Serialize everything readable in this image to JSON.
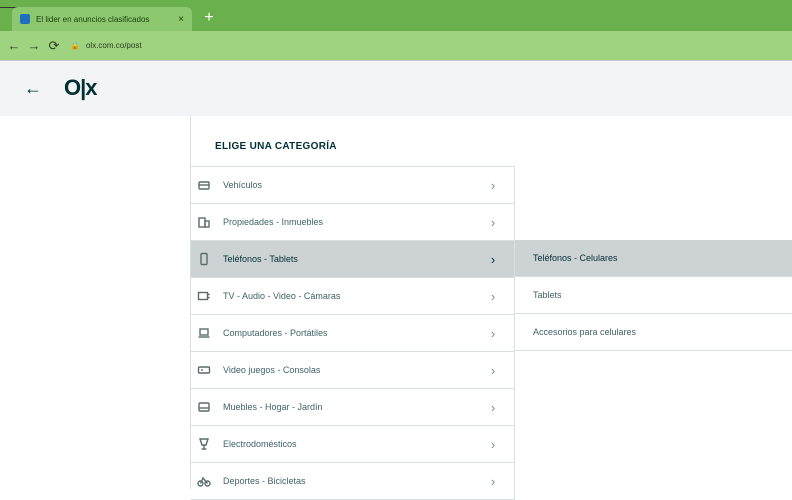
{
  "browser": {
    "tab": {
      "title": "El lider en anuncios clasificados",
      "favicon": "olx-favicon",
      "close": "×"
    },
    "new_tab": "+",
    "nav": {
      "back": "←",
      "forward": "→",
      "reload": "⟳"
    },
    "omnibox": {
      "lock": "🔒",
      "url": "olx.com.co/post"
    },
    "colors": {
      "tabstrip": "#6ab04c",
      "toolbar": "#9fd37f"
    }
  },
  "header": {
    "back_icon": "←",
    "logo": "O|x"
  },
  "panel": {
    "title": "ELIGE UNA CATEGORÍA",
    "categories": [
      {
        "label": "Vehículos",
        "icon": "car-icon",
        "selected": false
      },
      {
        "label": "Propiedades - Inmuebles",
        "icon": "building-icon",
        "selected": false
      },
      {
        "label": "Teléfonos - Tablets",
        "icon": "phone-icon",
        "selected": true
      },
      {
        "label": "TV - Audio - Video - Cámaras",
        "icon": "tv-icon",
        "selected": false
      },
      {
        "label": "Computadores - Portátiles",
        "icon": "laptop-icon",
        "selected": false
      },
      {
        "label": "Video juegos - Consolas",
        "icon": "gamepad-icon",
        "selected": false
      },
      {
        "label": "Muebles - Hogar - Jardín",
        "icon": "sofa-icon",
        "selected": false
      },
      {
        "label": "Electrodomésticos",
        "icon": "appliance-icon",
        "selected": false
      },
      {
        "label": "Deportes - Bicicletas",
        "icon": "bike-icon",
        "selected": false
      }
    ],
    "subcategories": [
      {
        "label": "Teléfonos - Celulares",
        "selected": true
      },
      {
        "label": "Tablets",
        "selected": false
      },
      {
        "label": "Accesorios para celulares",
        "selected": false
      }
    ],
    "chevron": "›",
    "colors": {
      "selected_bg": "#cdd3d4",
      "text": "#002f34"
    }
  }
}
